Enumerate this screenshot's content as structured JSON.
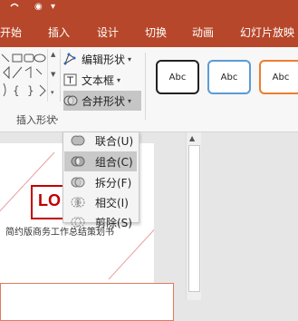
{
  "quick_access": {
    "record_glyph": "◉",
    "dropdown_glyph": "▾"
  },
  "tabs": [
    {
      "label": "开始"
    },
    {
      "label": "插入"
    },
    {
      "label": "设计"
    },
    {
      "label": "切换"
    },
    {
      "label": "动画"
    },
    {
      "label": "幻灯片放映"
    }
  ],
  "ribbon": {
    "edit_shape": "编辑形状",
    "text_box": "文本框",
    "merge_shapes": "合并形状",
    "group_label": "插入形状",
    "style_sample": "Abc"
  },
  "menu": {
    "items": [
      {
        "label": "联合(U)",
        "icon": "union-icon"
      },
      {
        "label": "组合(C)",
        "icon": "combine-icon"
      },
      {
        "label": "拆分(F)",
        "icon": "fragment-icon"
      },
      {
        "label": "相交(I)",
        "icon": "intersect-icon"
      },
      {
        "label": "剪除(S)",
        "icon": "subtract-icon"
      }
    ]
  },
  "slide": {
    "logo_text": "LO",
    "subtitle": "简约版商务工作总结策划书"
  },
  "colors": {
    "accent": "#b7472a",
    "style1": "#222222",
    "style2": "#5b9bd5",
    "style3": "#ed7d31"
  }
}
